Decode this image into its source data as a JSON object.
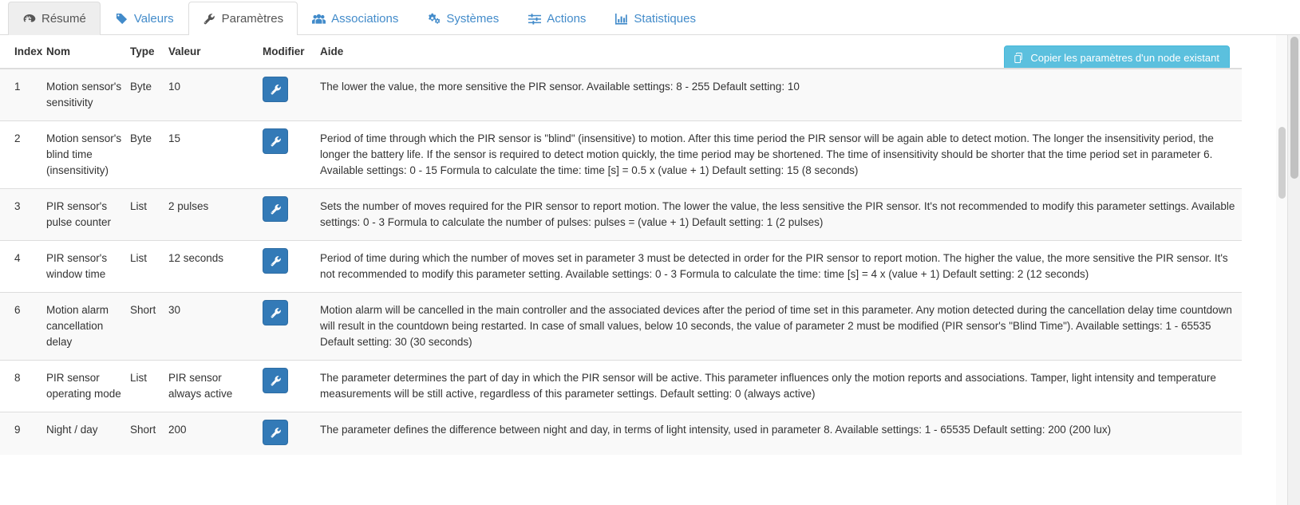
{
  "tabs": [
    {
      "label": "Résumé",
      "icon": "dashboard-icon",
      "state": "muted"
    },
    {
      "label": "Valeurs",
      "icon": "tag-icon",
      "state": "link"
    },
    {
      "label": "Paramètres",
      "icon": "wrench-icon",
      "state": "active"
    },
    {
      "label": "Associations",
      "icon": "users-icon",
      "state": "link"
    },
    {
      "label": "Systèmes",
      "icon": "cogs-icon",
      "state": "link"
    },
    {
      "label": "Actions",
      "icon": "sliders-icon",
      "state": "link"
    },
    {
      "label": "Statistiques",
      "icon": "bar-chart-icon",
      "state": "link"
    }
  ],
  "toolbar": {
    "copy_label": "Copier les paramètres d'un node existant",
    "copy_icon": "copy-icon",
    "copy_color": "#5bc0de"
  },
  "table": {
    "headers": [
      "Index",
      "Nom",
      "Type",
      "Valeur",
      "Modifier",
      "Aide"
    ],
    "edit_icon": "wrench-icon",
    "edit_color": "#337ab7",
    "rows": [
      {
        "index": "1",
        "nom": "Motion sensor's sensitivity",
        "type": "Byte",
        "valeur": "10",
        "aide": "The lower the value, the more sensitive the PIR sensor. Available settings: 8 - 255 Default setting: 10"
      },
      {
        "index": "2",
        "nom": "Motion sensor's blind time (insensitivity)",
        "type": "Byte",
        "valeur": "15",
        "aide": "Period of time through which the PIR sensor is \"blind\" (insensitive) to motion. After this time period the PIR sensor will be again able to detect motion. The longer the insensitivity period, the longer the battery life. If the sensor is required to detect motion quickly, the time period may be shortened. The time of insensitivity should be shorter that the time period set in parameter 6. Available settings: 0 - 15 Formula to calculate the time: time [s] = 0.5 x (value + 1) Default setting: 15 (8 seconds)"
      },
      {
        "index": "3",
        "nom": "PIR sensor's pulse counter",
        "type": "List",
        "valeur": "2 pulses",
        "aide": "Sets the number of moves required for the PIR sensor to report motion. The lower the value, the less sensitive the PIR sensor. It's not recommended to modify this parameter settings. Available settings: 0 - 3 Formula to calculate the number of pulses: pulses = (value + 1) Default setting: 1 (2 pulses)"
      },
      {
        "index": "4",
        "nom": "PIR sensor's window time",
        "type": "List",
        "valeur": "12 seconds",
        "aide": "Period of time during which the number of moves set in parameter 3 must be detected in order for the PIR sensor to report motion. The higher the value, the more sensitive the PIR sensor. It's not recommended to modify this parameter setting. Available settings: 0 - 3 Formula to calculate the time: time [s] = 4 x (value + 1) Default setting: 2 (12 seconds)"
      },
      {
        "index": "6",
        "nom": "Motion alarm cancellation delay",
        "type": "Short",
        "valeur": "30",
        "aide": "Motion alarm will be cancelled in the main controller and the associated devices after the period of time set in this parameter. Any motion detected during the cancellation delay time countdown will result in the countdown being restarted. In case of small values, below 10 seconds, the value of parameter 2 must be modified (PIR sensor's \"Blind Time\"). Available settings: 1 - 65535 Default setting: 30 (30 seconds)"
      },
      {
        "index": "8",
        "nom": "PIR sensor operating mode",
        "type": "List",
        "valeur": "PIR sensor always active",
        "aide": "The parameter determines the part of day in which the PIR sensor will be active. This parameter influences only the motion reports and associations. Tamper, light intensity and temperature measurements will be still active, regardless of this parameter settings. Default setting: 0 (always active)"
      },
      {
        "index": "9",
        "nom": "Night / day",
        "type": "Short",
        "valeur": "200",
        "aide": "The parameter defines the difference between night and day, in terms of light intensity, used in parameter 8. Available settings: 1 - 65535 Default setting: 200 (200 lux)"
      }
    ]
  }
}
